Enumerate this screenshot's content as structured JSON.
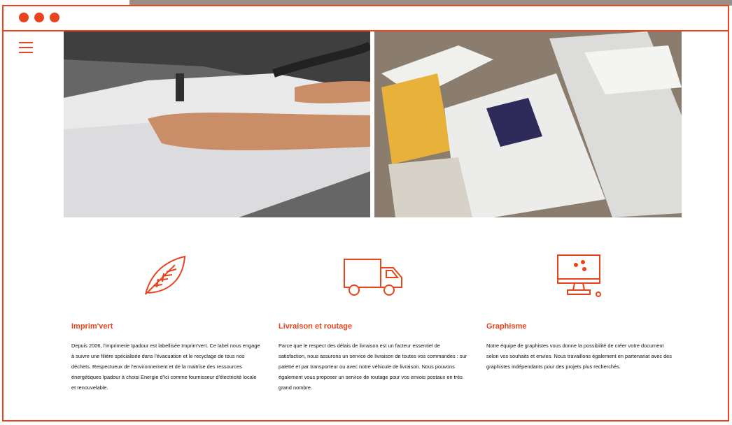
{
  "colors": {
    "accent": "#e8441d"
  },
  "window": {
    "controls": [
      "dot",
      "dot",
      "dot"
    ]
  },
  "menu": {
    "icon": "hamburger-menu-icon"
  },
  "features": [
    {
      "icon": "leaf-icon",
      "title": "Imprim'vert",
      "text": "Depuis 2006, l'imprimerie Ipadour est labellisée Imprim'vert. Ce label nous engage à suivre une filière spécialisée dans l'évacuation et le recyclage de tous nos déchets. Respectueux de l'environnement et de la maitrise des ressources énergétiques Ipadour à choisi Energie d'Ici comme fournisseur d'électricité locale et renouvelable."
    },
    {
      "icon": "delivery-truck-icon",
      "title": "Livraison et routage",
      "text": "Parce que le respect des délais de livraison est un facteur essentiel de satisfaction, nous assurons un service de livraison de toutes vos commandes : sur palette et par transporteur ou avec notre véhicule de livraison. Nous pouvons également vous proposer un service de routage pour vos envois postaux en très grand nombre."
    },
    {
      "icon": "computer-monitor-icon",
      "title": "Graphisme",
      "text": "Notre équipe de graphistes vous donne la possibilité de créer votre document selon vos souhaits et envies. Nous travaillons également en partenariat avec des graphistes indépendants pour des projets plus recherchés."
    }
  ]
}
